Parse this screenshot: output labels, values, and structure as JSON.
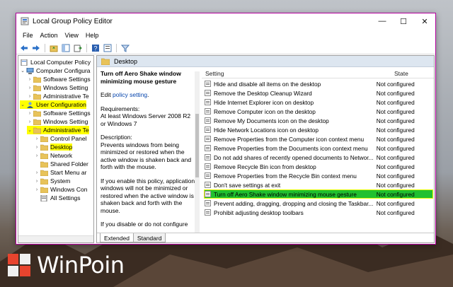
{
  "window": {
    "title": "Local Group Policy Editor",
    "controls": {
      "minimize": "—",
      "maximize": "☐",
      "close": "✕"
    },
    "accent": "#b4009e"
  },
  "menu": [
    "File",
    "Action",
    "View",
    "Help"
  ],
  "toolbar_icons": [
    "back-arrow-icon",
    "forward-arrow-icon",
    "folder-up-icon",
    "show-hide-tree-icon",
    "export-list-icon",
    "help-icon",
    "properties-icon",
    "filter-icon"
  ],
  "tree": [
    {
      "label": "Local Computer Policy",
      "chevron": "",
      "highlight": false
    },
    {
      "label": "Computer Configura",
      "chevron": "⌄",
      "highlight": false
    },
    {
      "label": "Software Settings",
      "chevron": "›",
      "highlight": false
    },
    {
      "label": "Windows Setting",
      "chevron": "›",
      "highlight": false
    },
    {
      "label": "Administrative Te",
      "chevron": "›",
      "highlight": false
    },
    {
      "label": "User Configuration",
      "chevron": "⌄",
      "highlight": true
    },
    {
      "label": "Software Settings",
      "chevron": "›",
      "highlight": false
    },
    {
      "label": "Windows Setting",
      "chevron": "›",
      "highlight": false
    },
    {
      "label": "Administrative Te",
      "chevron": "⌄",
      "highlight": true
    },
    {
      "label": "Control Panel",
      "chevron": "›",
      "highlight": false
    },
    {
      "label": "Desktop",
      "chevron": "›",
      "highlight": true
    },
    {
      "label": "Network",
      "chevron": "›",
      "highlight": false
    },
    {
      "label": "Shared Folder",
      "chevron": "",
      "highlight": false
    },
    {
      "label": "Start Menu ar",
      "chevron": "›",
      "highlight": false
    },
    {
      "label": "System",
      "chevron": "›",
      "highlight": false
    },
    {
      "label": "Windows Con",
      "chevron": "›",
      "highlight": false
    },
    {
      "label": "All Settings",
      "chevron": "",
      "highlight": false
    }
  ],
  "right_header": {
    "title": "Desktop"
  },
  "description": {
    "heading": "Turn off Aero Shake window minimizing mouse gesture",
    "edit_prefix": "Edit ",
    "edit_link": "policy setting",
    "edit_suffix": ".",
    "requirements": "Requirements:\nAt least Windows Server 2008 R2 or Windows 7",
    "description_text": "Description:\nPrevents windows from being minimized or restored when the active window is shaken back and forth with the mouse.",
    "enable_text": "If you enable this policy, application windows will not be minimized or restored when the active window is shaken back and forth with the mouse.",
    "disable_text": "If you disable or do not configure"
  },
  "list": {
    "columns": {
      "setting": "Setting",
      "state": "State"
    },
    "rows": [
      {
        "name": "Hide and disable all items on the desktop",
        "state": "Not configured",
        "selected": false
      },
      {
        "name": "Remove the Desktop Cleanup Wizard",
        "state": "Not configured",
        "selected": false
      },
      {
        "name": "Hide Internet Explorer icon on desktop",
        "state": "Not configured",
        "selected": false
      },
      {
        "name": "Remove Computer icon on the desktop",
        "state": "Not configured",
        "selected": false
      },
      {
        "name": "Remove My Documents icon on the desktop",
        "state": "Not configured",
        "selected": false
      },
      {
        "name": "Hide Network Locations icon on desktop",
        "state": "Not configured",
        "selected": false
      },
      {
        "name": "Remove Properties from the Computer icon context menu",
        "state": "Not configured",
        "selected": false
      },
      {
        "name": "Remove Properties from the Documents icon context menu",
        "state": "Not configured",
        "selected": false
      },
      {
        "name": "Do not add shares of recently opened documents to Networ...",
        "state": "Not configured",
        "selected": false
      },
      {
        "name": "Remove Recycle Bin icon from desktop",
        "state": "Not configured",
        "selected": false
      },
      {
        "name": "Remove Properties from the Recycle Bin context menu",
        "state": "Not configured",
        "selected": false
      },
      {
        "name": "Don't save settings at exit",
        "state": "Not configured",
        "selected": false
      },
      {
        "name": "Turn off Aero Shake window minimizing mouse gesture",
        "state": "Not configured",
        "selected": true
      },
      {
        "name": "Prevent adding, dragging, dropping and closing the Taskbar...",
        "state": "Not configured",
        "selected": false
      },
      {
        "name": "Prohibit adjusting desktop toolbars",
        "state": "Not configured",
        "selected": false
      }
    ]
  },
  "tabs": [
    "Extended",
    "Standard"
  ],
  "colors": {
    "selection": "#20c030",
    "highlight": "#ffff00",
    "header": "#dde6f0",
    "folder": "#e8c35a"
  },
  "watermark": {
    "text": "WinPoin"
  }
}
